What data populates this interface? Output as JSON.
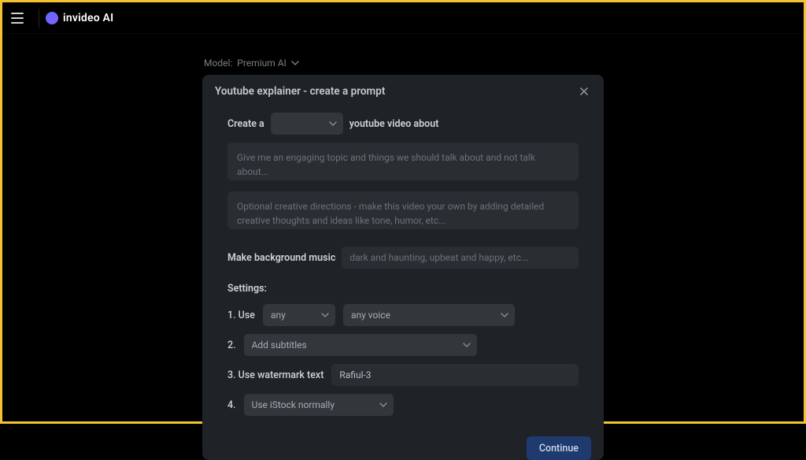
{
  "brand": {
    "name": "invideo AI"
  },
  "model": {
    "prefix": "Model:",
    "name": "Premium AI"
  },
  "card": {
    "title": "Youtube explainer - create a prompt",
    "prompt": {
      "prefix": "Create a",
      "duration_selected": "",
      "suffix": "youtube video about",
      "topic_placeholder": "Give me an engaging topic and things we should talk about and not talk about...",
      "directions_placeholder": "Optional creative directions - make this video your own by adding detailed creative thoughts and ideas like tone, humor, etc..."
    },
    "bgmusic": {
      "label": "Make background music",
      "placeholder": "dark and haunting, upbeat and happy, etc..."
    },
    "settings": {
      "heading": "Settings:",
      "row1": {
        "num": "1. Use",
        "gender": "any",
        "voice": "any voice"
      },
      "row2": {
        "num": "2.",
        "subtitles": "Add subtitles"
      },
      "row3": {
        "num": "3. Use watermark text",
        "value": "Rafiul-3"
      },
      "row4": {
        "num": "4.",
        "stock": "Use iStock normally"
      }
    },
    "continue": "Continue"
  }
}
